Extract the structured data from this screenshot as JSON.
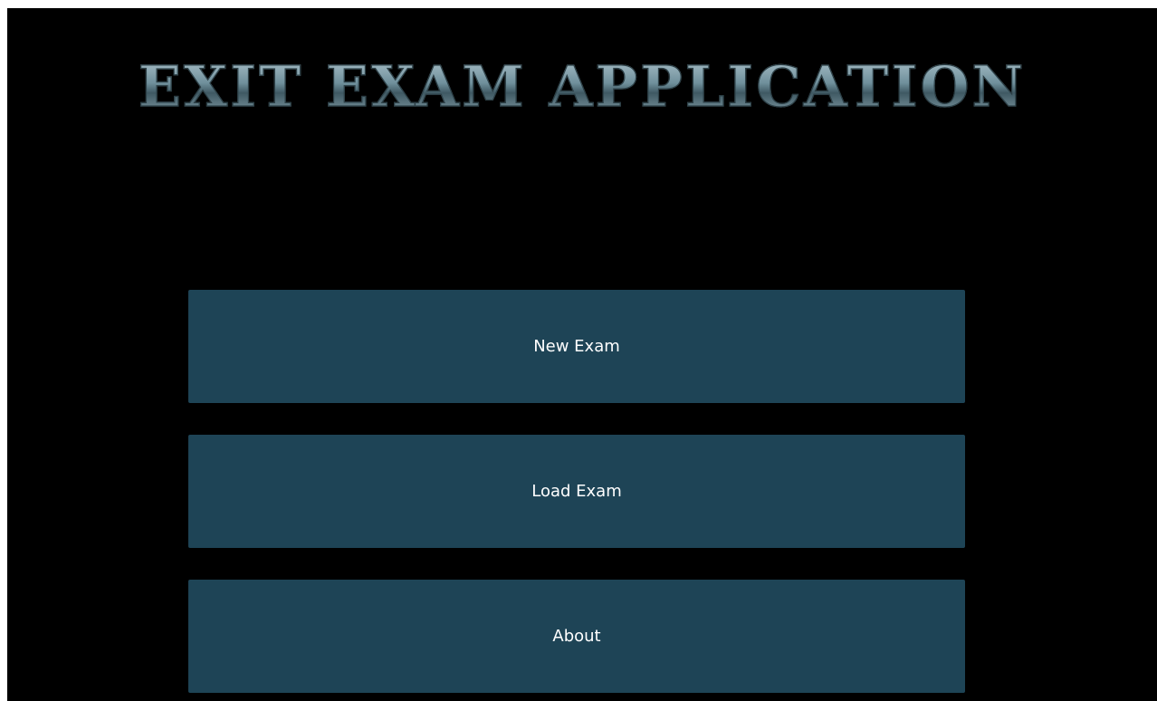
{
  "app": {
    "title": "EXIT EXAM APPLICATION"
  },
  "menu": {
    "new_exam_label": "New Exam",
    "load_exam_label": "Load Exam",
    "about_label": "About"
  },
  "colors": {
    "background": "#000000",
    "button": "#1e4456",
    "button_text": "#ffffff",
    "title": "#6e8d99"
  }
}
